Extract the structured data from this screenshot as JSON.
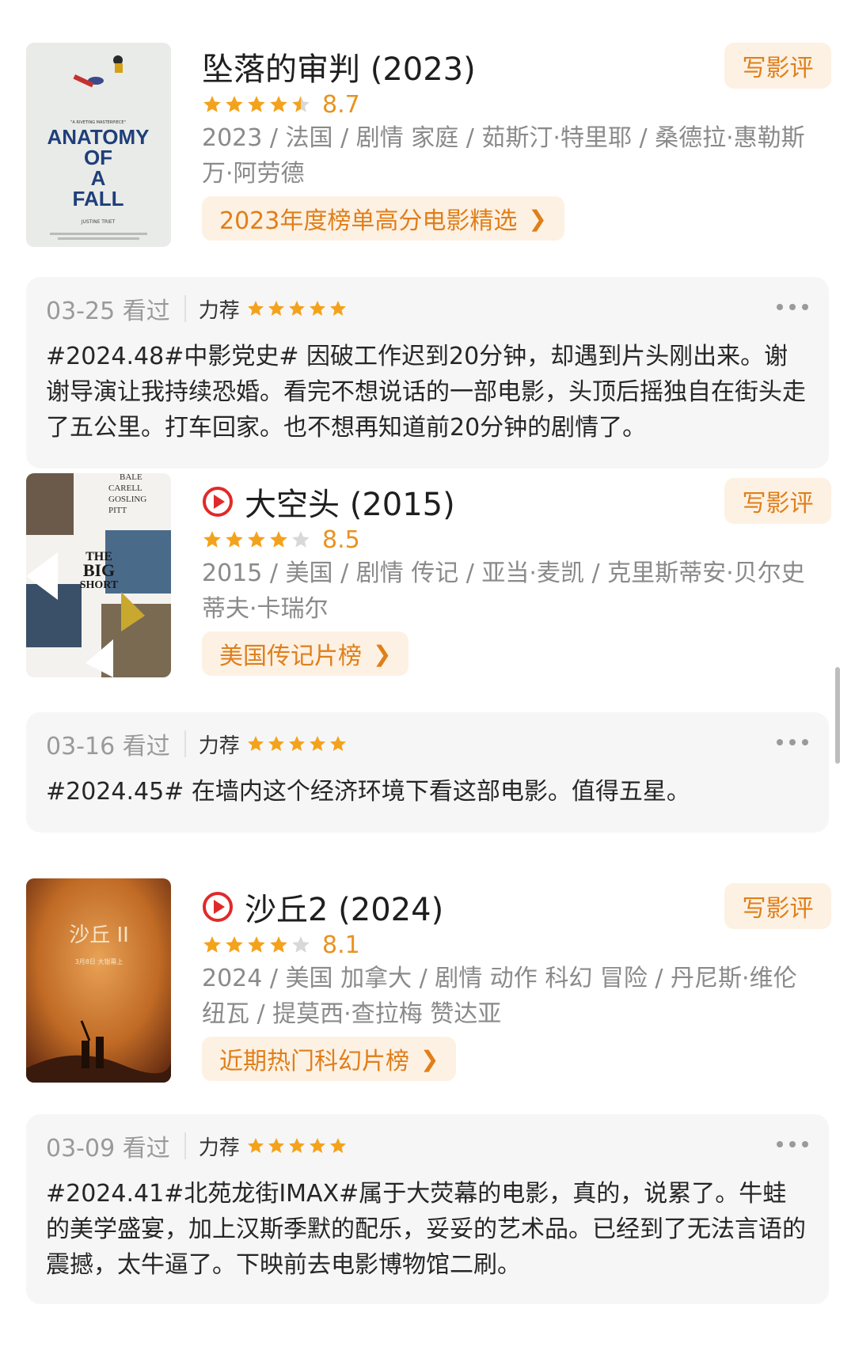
{
  "colors": {
    "accent": "#e07f1a",
    "star": "#f4a21c",
    "star_empty": "#d8d8d8",
    "play": "#e02a2a"
  },
  "entries": [
    {
      "title": "坠落的审判 (2023)",
      "has_play_icon": false,
      "write_review": "写影评",
      "stars_filled": 4.5,
      "score": "8.7",
      "meta": "2023 / 法国 / 剧情 家庭 / 茹斯汀·特里耶 / 桑德拉·惠勒斯万·阿劳德",
      "rank": "2023年度榜单高分电影精选",
      "review": {
        "date": "03-25 看过",
        "rec": "力荐",
        "stars": 5,
        "text": "#2024.48#中影党史# 因破工作迟到20分钟，却遇到片头刚出来。谢谢导演让我持续恐婚。看完不想说话的一部电影，头顶后摇独自在街头走了五公里。打车回家。也不想再知道前20分钟的剧情了。"
      },
      "poster": {
        "label_lines": [
          "ANATOMY",
          "OF",
          "A",
          "FALL"
        ],
        "tagline": "\"A RIVETING MASTERPIECE\"",
        "credit": "JUSTINE TRIET"
      }
    },
    {
      "title": "大空头 (2015)",
      "has_play_icon": true,
      "write_review": "写影评",
      "stars_filled": 4,
      "score": "8.5",
      "meta": "2015 / 美国 / 剧情 传记 / 亚当·麦凯 / 克里斯蒂安·贝尔史蒂夫·卡瑞尔",
      "rank": "美国传记片榜",
      "review": {
        "date": "03-16 看过",
        "rec": "力荐",
        "stars": 5,
        "text": "#2024.45# 在墙内这个经济环境下看这部电影。值得五星。"
      },
      "poster": {
        "label_lines": [
          "THE",
          "BIG",
          "SHORT"
        ],
        "cast": [
          "BALE",
          "CARELL",
          "GOSLING",
          "PITT"
        ]
      }
    },
    {
      "title": "沙丘2 (2024)",
      "has_play_icon": true,
      "write_review": "写影评",
      "stars_filled": 4,
      "score": "8.1",
      "meta": "2024 / 美国 加拿大 / 剧情 动作 科幻 冒险 / 丹尼斯·维伦纽瓦 / 提莫西·查拉梅 赞达亚",
      "rank": "近期热门科幻片榜",
      "review": {
        "date": "03-09 看过",
        "rec": "力荐",
        "stars": 5,
        "text": "#2024.41#北苑龙街IMAX#属于大荧幕的电影，真的，说累了。牛蛙的美学盛宴，加上汉斯季默的配乐，妥妥的艺术品。已经到了无法言语的震撼，太牛逼了。下映前去电影博物馆二刷。"
      },
      "poster": {
        "label": "沙丘 II",
        "date_line": "3月8日 大银幕上"
      }
    }
  ]
}
